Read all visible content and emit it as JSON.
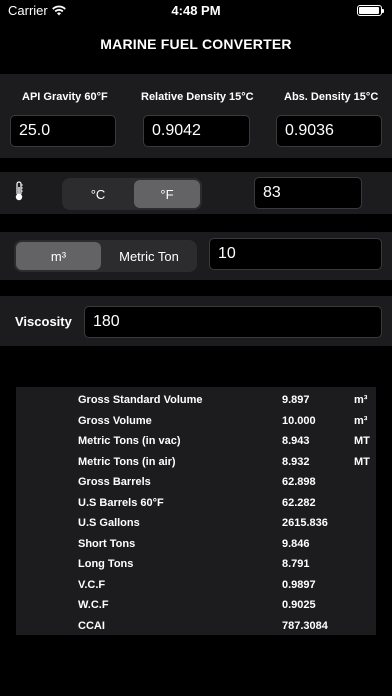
{
  "status_bar": {
    "carrier": "Carrier",
    "time": "4:48 PM",
    "battery_level": 0.95
  },
  "app_title": "MARINE FUEL CONVERTER",
  "density": {
    "api_gravity": {
      "label": "API Gravity 60°F",
      "value": "25.0"
    },
    "relative_density": {
      "label": "Relative Density 15°C",
      "value": "0.9042"
    },
    "abs_density": {
      "label": "Abs. Density 15°C",
      "value": "0.9036"
    }
  },
  "temperature": {
    "icon": "thermometer-icon",
    "units": [
      {
        "label": "°C",
        "selected": false
      },
      {
        "label": "°F",
        "selected": true
      }
    ],
    "value": "83"
  },
  "volume": {
    "units": [
      {
        "label": "m³",
        "selected": true
      },
      {
        "label": "Metric Ton",
        "selected": false
      }
    ],
    "value": "10"
  },
  "viscosity": {
    "label": "Viscosity",
    "value": "180"
  },
  "results": [
    {
      "label": "Gross Standard Volume",
      "value": "9.897",
      "unit": "m³"
    },
    {
      "label": "Gross Volume",
      "value": "10.000",
      "unit": "m³"
    },
    {
      "label": "Metric Tons (in vac)",
      "value": "8.943",
      "unit": "MT"
    },
    {
      "label": "Metric Tons (in air)",
      "value": "8.932",
      "unit": "MT"
    },
    {
      "label": "Gross Barrels",
      "value": "62.898",
      "unit": ""
    },
    {
      "label": "U.S Barrels 60°F",
      "value": "62.282",
      "unit": ""
    },
    {
      "label": "U.S Gallons",
      "value": "2615.836",
      "unit": ""
    },
    {
      "label": "Short Tons",
      "value": "9.846",
      "unit": ""
    },
    {
      "label": "Long Tons",
      "value": "8.791",
      "unit": ""
    },
    {
      "label": "V.C.F",
      "value": "0.9897",
      "unit": ""
    },
    {
      "label": "W.C.F",
      "value": "0.9025",
      "unit": ""
    },
    {
      "label": "CCAI",
      "value": "787.3084",
      "unit": ""
    }
  ]
}
